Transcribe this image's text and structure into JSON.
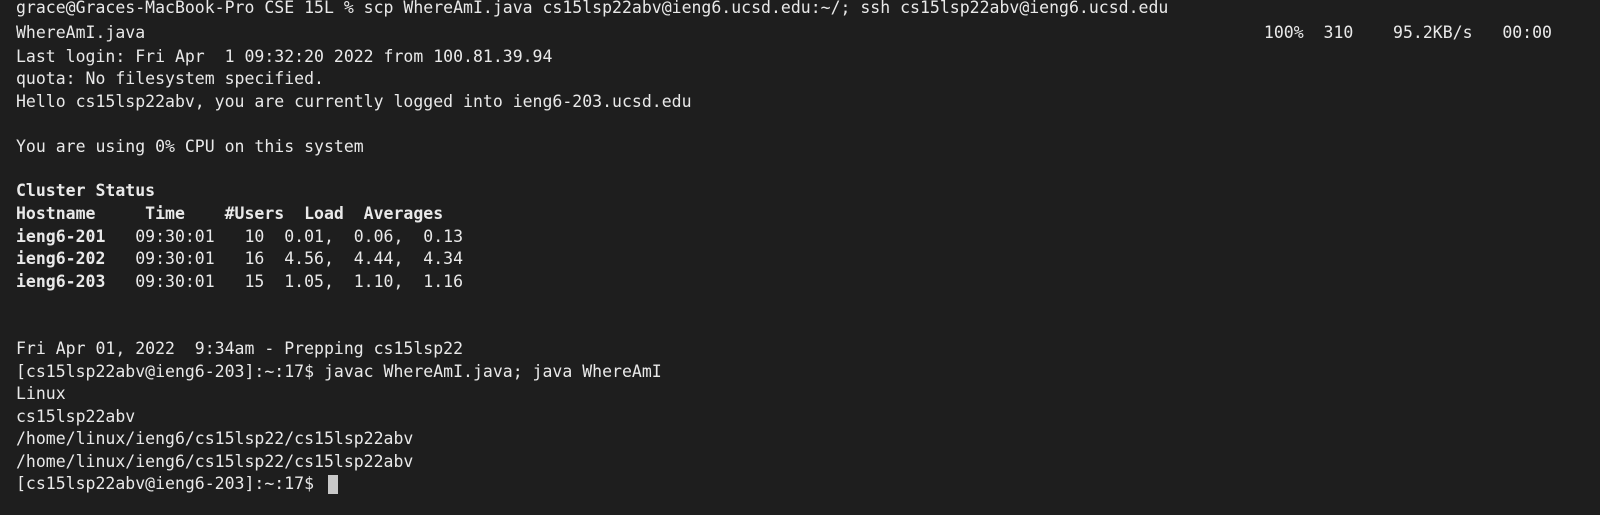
{
  "terminal": {
    "lines": [
      "grace@Graces-MacBook-Pro CSE 15L % scp WhereAmI.java cs15lsp22abv@ieng6.ucsd.edu:~/; ssh cs15lsp22abv@ieng6.ucsd.edu",
      "WhereAmI.java",
      "Last login: Fri Apr  1 09:32:20 2022 from 100.81.39.94",
      "quota: No filesystem specified.",
      "Hello cs15lsp22abv, you are currently logged into ieng6-203.ucsd.edu",
      "",
      "You are using 0% CPU on this system",
      "",
      "Cluster Status",
      "Hostname     Time    #Users  Load  Averages",
      "ieng6-201   09:30:01   10  0.01,  0.06,  0.13",
      "ieng6-202   09:30:01   16  4.56,  4.44,  4.34",
      "ieng6-203   09:30:01   15  1.05,  1.10,  1.16",
      "",
      "",
      "Fri Apr 01, 2022  9:34am - Prepping cs15lsp22",
      "[cs15lsp22abv@ieng6-203]:~:17$ javac WhereAmI.java; java WhereAmI",
      "Linux",
      "cs15lsp22abv",
      "/home/linux/ieng6/cs15lsp22/cs15lsp22abv",
      "/home/linux/ieng6/cs15lsp22/cs15lsp22abv",
      "[cs15lsp22abv@ieng6-203]:~:17$ "
    ],
    "scp_progress": "100%  310    95.2KB/s   00:00",
    "background": "#1e1e1e",
    "foreground": "#e9e9e9",
    "cursor_color": "#c8c8c8"
  }
}
